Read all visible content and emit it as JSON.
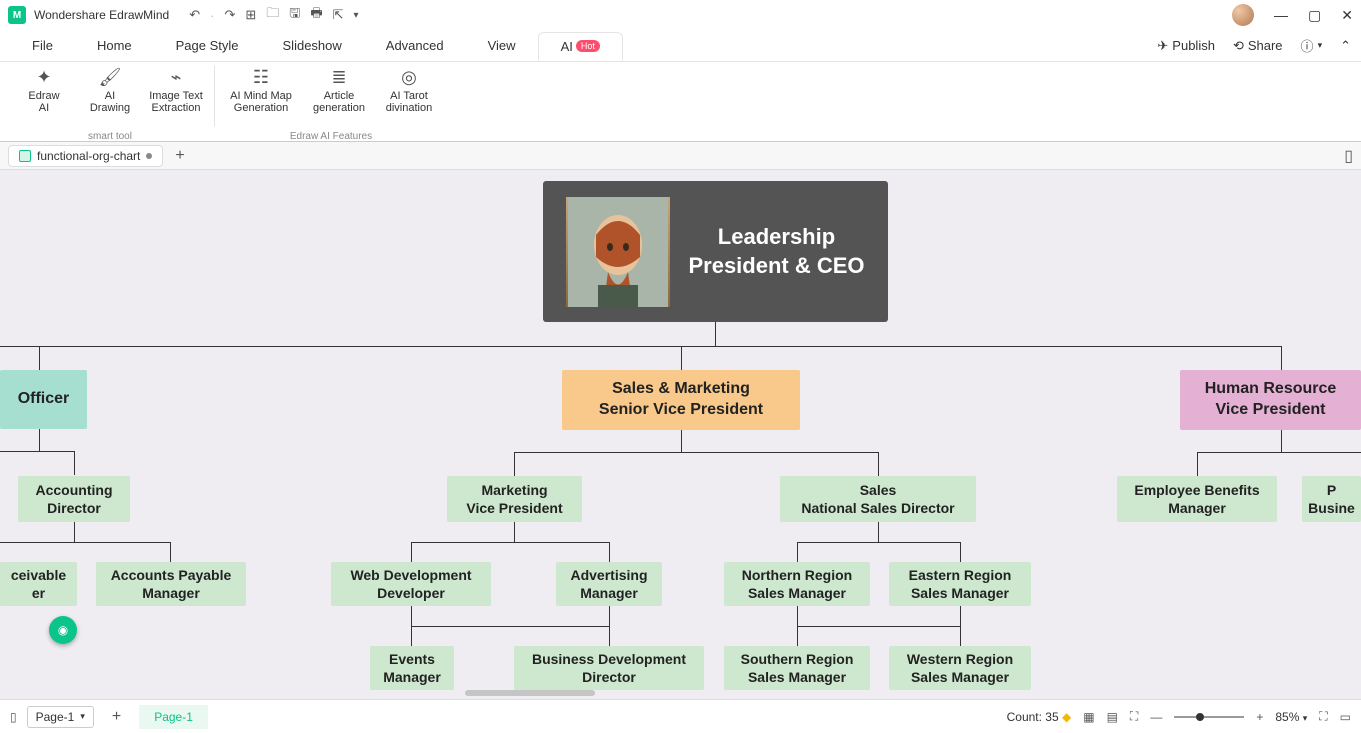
{
  "app": {
    "title": "Wondershare EdrawMind"
  },
  "menu": {
    "file": "File",
    "home": "Home",
    "pagestyle": "Page Style",
    "slideshow": "Slideshow",
    "advanced": "Advanced",
    "view": "View",
    "ai": "AI",
    "hot": "Hot",
    "publish": "Publish",
    "share": "Share"
  },
  "ribbon": {
    "edrawai": "Edraw\nAI",
    "aidrawing": "AI\nDrawing",
    "imgtext": "Image Text\nExtraction",
    "g1": "smart tool",
    "mindmap": "AI Mind Map\nGeneration",
    "article": "Article\ngeneration",
    "tarot": "AI Tarot\ndivination",
    "g2": "Edraw AI Features"
  },
  "doc": {
    "name": "functional-org-chart"
  },
  "nodes": {
    "ceo1": "Leadership",
    "ceo2": "President & CEO",
    "sales1": "Sales & Marketing",
    "sales2": "Senior Vice President",
    "hr1": "Human Resource",
    "hr2": "Vice President",
    "fin": "Officer",
    "acct1": "Accounting",
    "acct2": "Director",
    "mkt1": "Marketing",
    "mkt2": "Vice President",
    "slsd1": "Sales",
    "slsd2": "National Sales Director",
    "emp1": "Employee Benefits",
    "emp2": "Manager",
    "p1": "P",
    "p2": "Busine",
    "recv1": "ceivable",
    "recv2": "er",
    "pay1": "Accounts Payable",
    "pay2": "Manager",
    "web1": "Web Development",
    "web2": "Developer",
    "adv1": "Advertising",
    "adv2": "Manager",
    "nr1": "Northern Region",
    "nr2": "Sales Manager",
    "er1": "Eastern Region",
    "er2": "Sales Manager",
    "ev1": "Events",
    "ev2": "Manager",
    "bd1": "Business Development",
    "bd2": "Director",
    "sr1": "Southern Region",
    "sr2": "Sales Manager",
    "wr1": "Western Region",
    "wr2": "Sales Manager"
  },
  "status": {
    "pagesel": "Page-1",
    "pagetab": "Page-1",
    "count": "Count: 35",
    "zoom": "85%"
  }
}
